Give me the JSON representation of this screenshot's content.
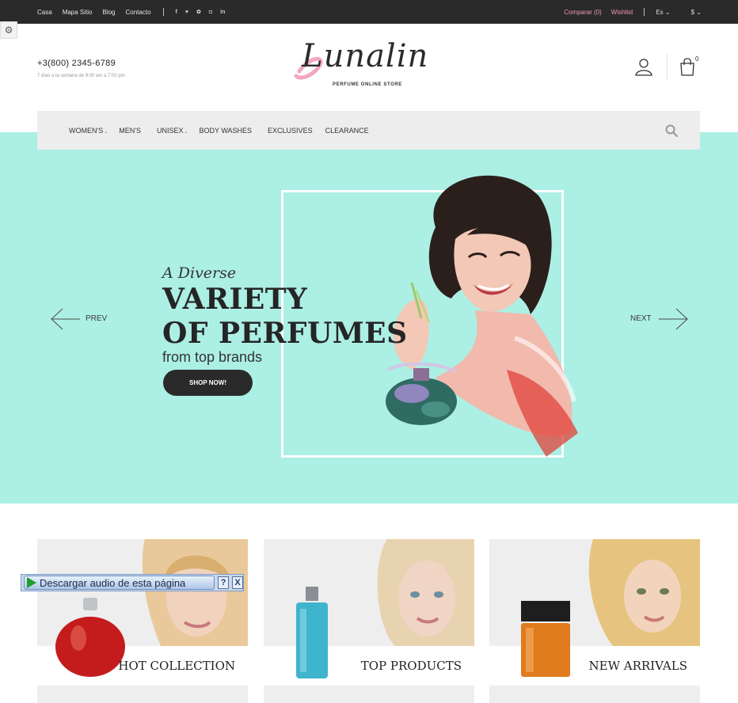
{
  "topbar": {
    "links": [
      "Casa",
      "Mapa Sitio",
      "Blog",
      "Contacto"
    ],
    "social_icons": [
      "facebook-icon",
      "twitter-icon",
      "pinterest-icon",
      "instagram-icon",
      "linkedin-icon"
    ],
    "compare": "Comparar (0)",
    "wishlist": "Wishlist",
    "language": "Es",
    "currency": "$"
  },
  "header": {
    "phone": "+3(800) 2345-6789",
    "hours": "7 días a la semana de 9:00 am a 7:00 pm",
    "logo_text": "Lunalin",
    "logo_sub": "PERFUME ONLINE STORE",
    "cart_count": "0"
  },
  "nav": {
    "items": [
      "WOMEN'S",
      "MEN'S",
      "UNISEX",
      "BODY WASHES",
      "EXCLUSIVES",
      "CLEARANCE"
    ]
  },
  "hero": {
    "subtitle": "A Diverse",
    "title_line1": "VARIETY",
    "title_line2": "OF PERFUMES",
    "tagline": "from top brands",
    "cta": "SHOP NOW!",
    "prev": "PREV",
    "next": "NEXT"
  },
  "collections": [
    {
      "label": "HOT COLLECTION"
    },
    {
      "label": "TOP PRODUCTS"
    },
    {
      "label": "NEW ARRIVALS"
    }
  ],
  "audio_widget": {
    "label": "Descargar audio de esta página",
    "help": "?",
    "close": "X"
  },
  "colors": {
    "hero_bg": "#acefe4",
    "topbar_bg": "#2a2a2a",
    "accent_pink": "#f19ab5"
  }
}
